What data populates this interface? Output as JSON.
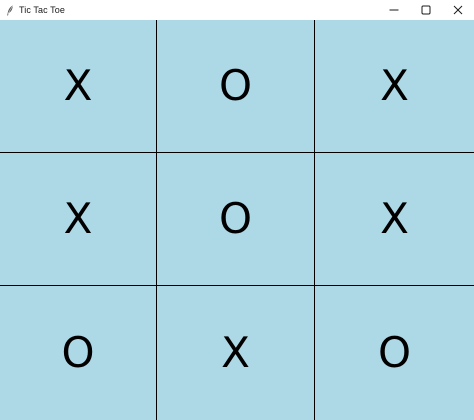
{
  "window": {
    "title": "Tic Tac Toe",
    "icon": "feather-icon",
    "controls": [
      "minimize-icon",
      "maximize-icon",
      "close-icon"
    ]
  },
  "board": {
    "cell_color": "#add8e6",
    "grid_color": "#000000",
    "cells": [
      [
        "X",
        "O",
        "X"
      ],
      [
        "X",
        "O",
        "X"
      ],
      [
        "O",
        "X",
        "O"
      ]
    ]
  }
}
